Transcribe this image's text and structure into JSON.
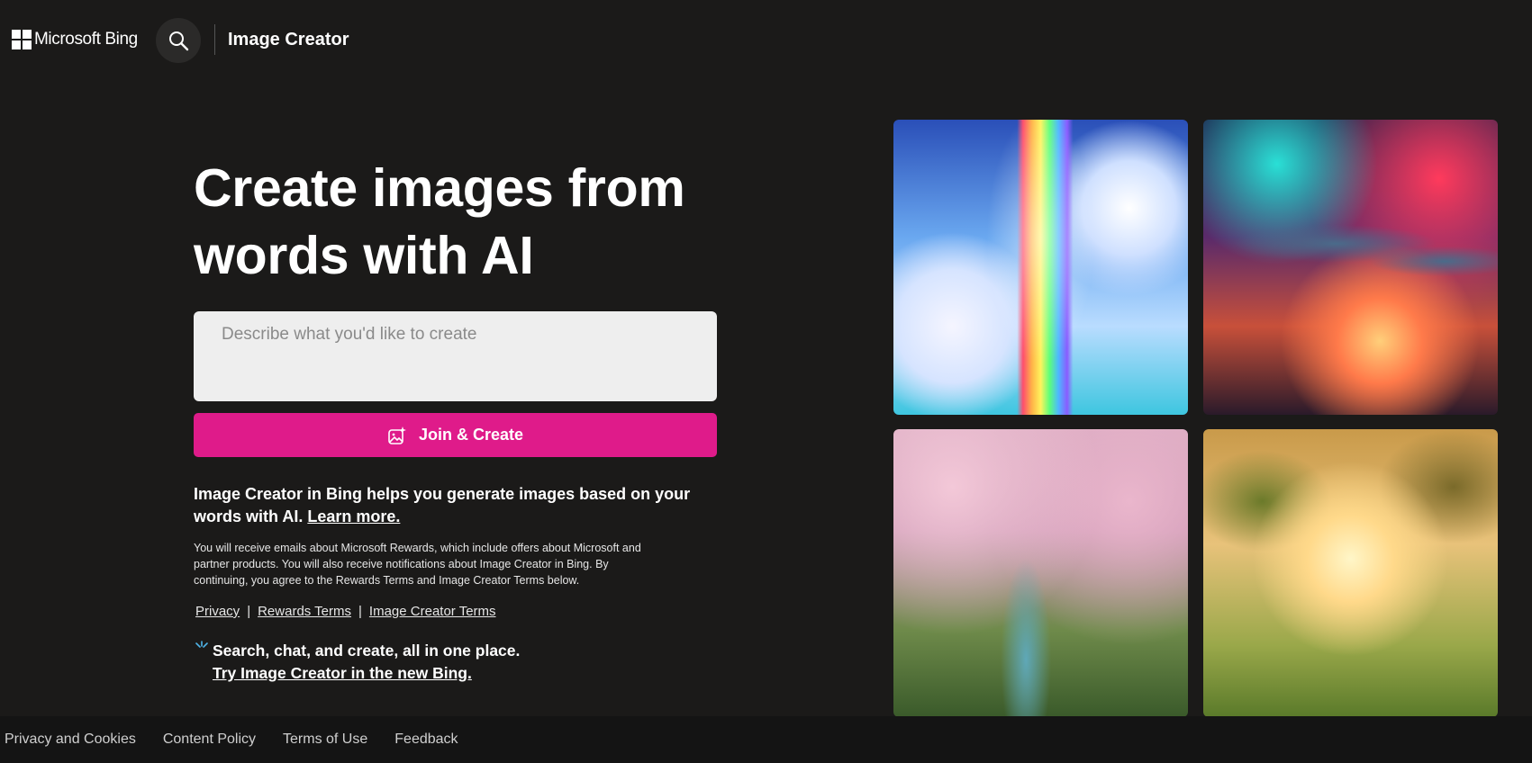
{
  "header": {
    "logo_text": "Microsoft Bing",
    "app_title": "Image Creator"
  },
  "hero": {
    "title_line1": "Create images from",
    "title_line2": "words with AI"
  },
  "prompt": {
    "placeholder": "Describe what you'd like to create",
    "value": ""
  },
  "create_button": {
    "label": "Join & Create"
  },
  "description": {
    "text": "Image Creator in Bing helps you generate images based on your words with AI.",
    "learn_more": "Learn more."
  },
  "fine_print": "You will receive emails about Microsoft Rewards, which include offers about Microsoft and partner products. You will also receive notifications about Image Creator in Bing. By continuing, you agree to the Rewards Terms and Image Creator Terms below.",
  "legal_links": {
    "privacy": "Privacy",
    "rewards_terms": "Rewards Terms",
    "image_creator_terms": "Image Creator Terms",
    "separator": "|"
  },
  "promo": {
    "text": "Search, chat, and create, all in one place.",
    "link": "Try Image Creator in the new Bing."
  },
  "gallery": {
    "images": [
      "floating-islands-rainbow-waterfall",
      "futuristic-space-city",
      "cherry-blossom-stream",
      "child-flying-kite-park"
    ]
  },
  "footer": {
    "links": [
      "Privacy and Cookies",
      "Content Policy",
      "Terms of Use",
      "Feedback"
    ]
  },
  "colors": {
    "background": "#1b1a19",
    "accent": "#df1b8a",
    "input_bg": "#eeeeee"
  }
}
